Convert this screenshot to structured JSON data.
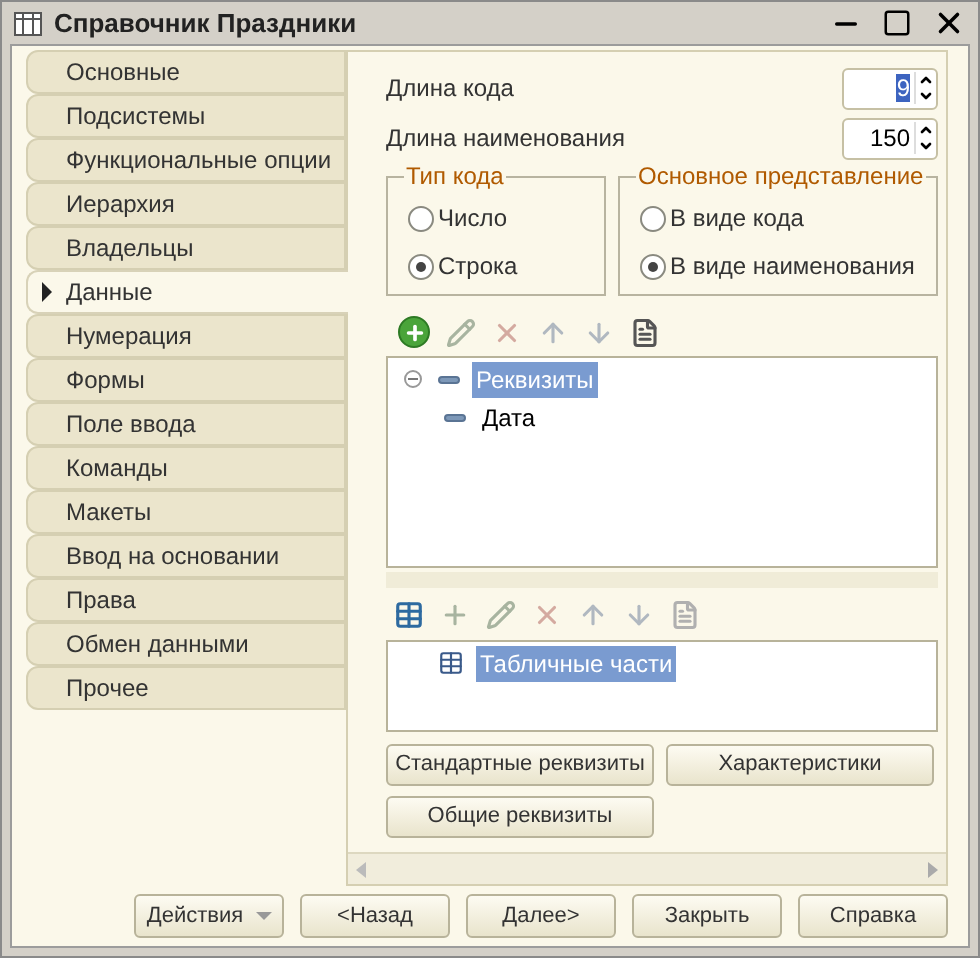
{
  "window": {
    "title": "Справочник Праздники"
  },
  "tabs": [
    {
      "label": "Основные",
      "selected": false
    },
    {
      "label": "Подсистемы",
      "selected": false
    },
    {
      "label": "Функциональные опции",
      "selected": false
    },
    {
      "label": "Иерархия",
      "selected": false
    },
    {
      "label": "Владельцы",
      "selected": false
    },
    {
      "label": "Данные",
      "selected": true
    },
    {
      "label": "Нумерация",
      "selected": false
    },
    {
      "label": "Формы",
      "selected": false
    },
    {
      "label": "Поле ввода",
      "selected": false
    },
    {
      "label": "Команды",
      "selected": false
    },
    {
      "label": "Макеты",
      "selected": false
    },
    {
      "label": "Ввод на основании",
      "selected": false
    },
    {
      "label": "Права",
      "selected": false
    },
    {
      "label": "Обмен данными",
      "selected": false
    },
    {
      "label": "Прочее",
      "selected": false
    }
  ],
  "fields": [
    {
      "label": "Длина кода",
      "value": "9",
      "highlighted": true
    },
    {
      "label": "Длина наименования",
      "value": "150",
      "highlighted": false
    }
  ],
  "groups": [
    {
      "title": "Тип кода",
      "options": [
        {
          "label": "Число",
          "selected": false
        },
        {
          "label": "Строка",
          "selected": true
        }
      ]
    },
    {
      "title": "Основное представление",
      "options": [
        {
          "label": "В виде кода",
          "selected": false
        },
        {
          "label": "В виде наименования",
          "selected": true
        }
      ]
    }
  ],
  "attributes_tree": [
    {
      "label": "Реквизиты",
      "expanded": true,
      "selected": true,
      "children": [
        {
          "label": "Дата",
          "selected": false
        }
      ]
    }
  ],
  "tabular_tree": [
    {
      "label": "Табличные части",
      "selected": true
    }
  ],
  "panel_buttons": [
    "Стандартные реквизиты",
    "Характеристики",
    "Общие реквизиты"
  ],
  "footer_buttons": [
    {
      "label": "Действия",
      "kind": "menu"
    },
    {
      "label": "<Назад",
      "kind": "plain"
    },
    {
      "label": "Далее>",
      "kind": "plain"
    },
    {
      "label": "Закрыть",
      "kind": "plain"
    },
    {
      "label": "Справка",
      "kind": "plain"
    }
  ]
}
